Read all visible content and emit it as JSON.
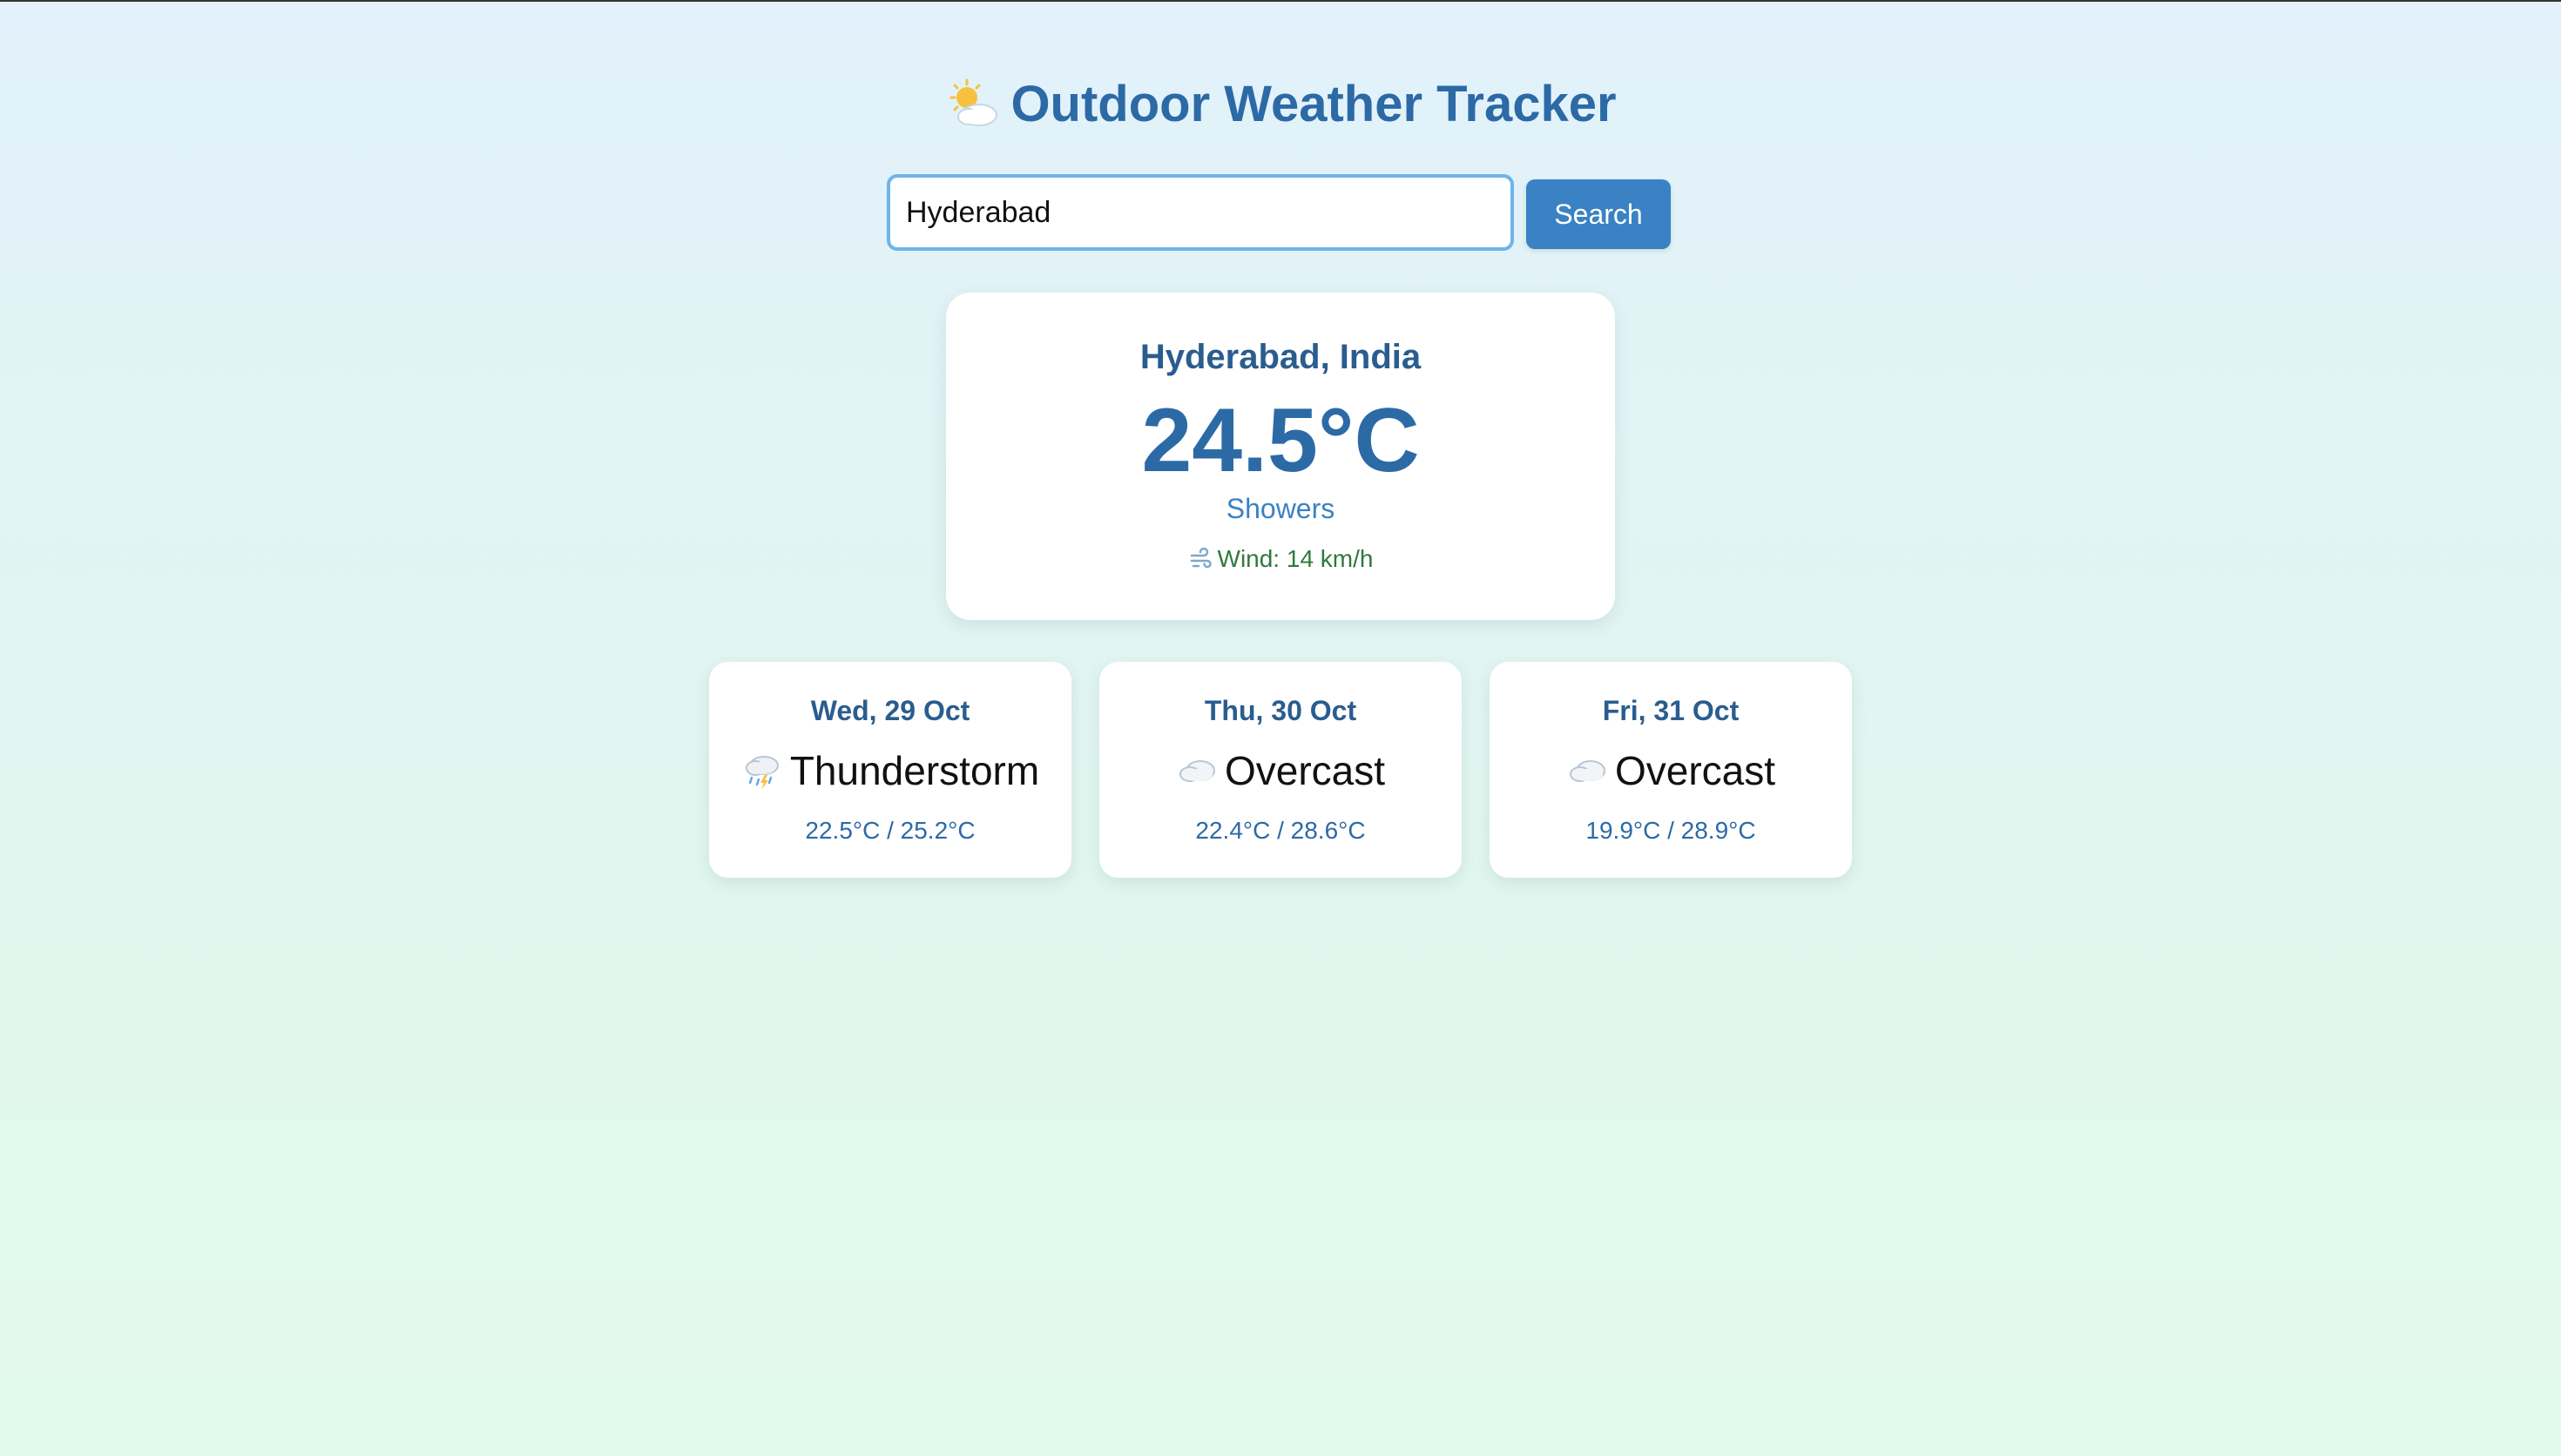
{
  "app": {
    "title": "Outdoor Weather Tracker",
    "title_icon": "sun-behind-cloud-icon"
  },
  "search": {
    "value": "Hyderabad",
    "button_label": "Search"
  },
  "current": {
    "location": "Hyderabad, India",
    "temperature": "24.5°C",
    "condition": "Showers",
    "wind_icon": "wind-icon",
    "wind": "Wind: 14 km/h"
  },
  "forecast": [
    {
      "date": "Wed, 29 Oct",
      "icon": "thunderstorm-cloud-icon",
      "condition": "Thunderstorm",
      "range": "22.5°C / 25.2°C"
    },
    {
      "date": "Thu, 30 Oct",
      "icon": "cloud-icon",
      "condition": "Overcast",
      "range": "22.4°C / 28.6°C"
    },
    {
      "date": "Fri, 31 Oct",
      "icon": "cloud-icon",
      "condition": "Overcast",
      "range": "19.9°C / 28.9°C"
    }
  ],
  "colors": {
    "title": "#2c6aa6",
    "accent": "#3a82c4",
    "wind_text": "#2e7a3c",
    "input_border": "#6cb5ea"
  }
}
